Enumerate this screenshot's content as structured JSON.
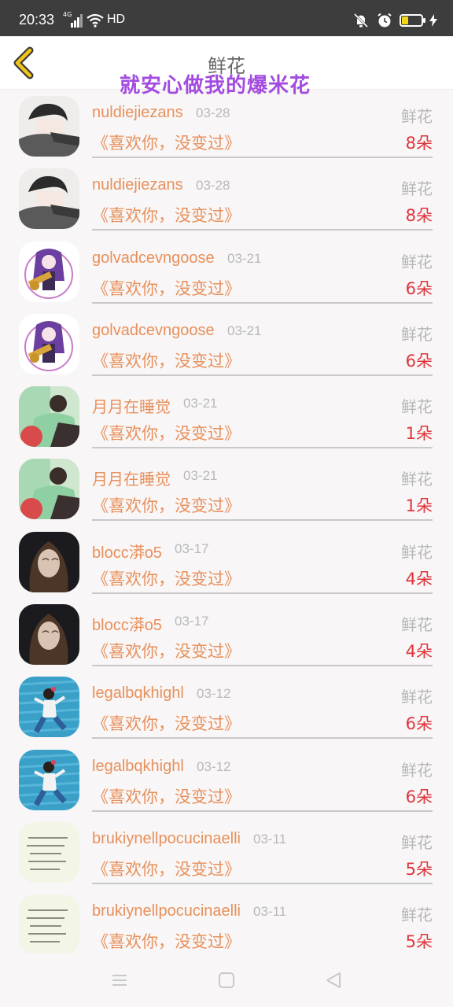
{
  "status_bar": {
    "time": "20:33",
    "network": "4G",
    "hd": "HD",
    "icons": [
      "signal-icon",
      "wifi-icon",
      "mute-icon",
      "alarm-icon",
      "battery-icon",
      "charging-icon"
    ]
  },
  "header": {
    "title": "鲜花",
    "back_icon": "chevron-left-icon"
  },
  "overlay": {
    "text": "就安心做我的爆米花"
  },
  "items": [
    {
      "name": "nuldiejiezans",
      "date": "03-28",
      "gift": "鲜花",
      "message": "《喜欢你，没变过》",
      "count": "8朵",
      "avatar": "anime-boy"
    },
    {
      "name": "nuldiejiezans",
      "date": "03-28",
      "gift": "鲜花",
      "message": "《喜欢你，没变过》",
      "count": "8朵",
      "avatar": "anime-boy"
    },
    {
      "name": "golvadcevngoose",
      "date": "03-21",
      "gift": "鲜花",
      "message": "《喜欢你，没变过》",
      "count": "6朵",
      "avatar": "anime-girl"
    },
    {
      "name": "golvadcevngoose",
      "date": "03-21",
      "gift": "鲜花",
      "message": "《喜欢你，没变过》",
      "count": "6朵",
      "avatar": "anime-girl"
    },
    {
      "name": "月月在睡觉",
      "date": "03-21",
      "gift": "鲜花",
      "message": "《喜欢你，没变过》",
      "count": "1朵",
      "avatar": "photo-green"
    },
    {
      "name": "月月在睡觉",
      "date": "03-21",
      "gift": "鲜花",
      "message": "《喜欢你，没变过》",
      "count": "1朵",
      "avatar": "photo-green"
    },
    {
      "name": "blocc漭o5",
      "date": "03-17",
      "gift": "鲜花",
      "message": "《喜欢你，没变过》",
      "count": "4朵",
      "avatar": "photo-woman"
    },
    {
      "name": "blocc漭o5",
      "date": "03-17",
      "gift": "鲜花",
      "message": "《喜欢你，没变过》",
      "count": "4朵",
      "avatar": "photo-woman"
    },
    {
      "name": "legalbqkhighl",
      "date": "03-12",
      "gift": "鲜花",
      "message": "《喜欢你，没变过》",
      "count": "6朵",
      "avatar": "photo-blue"
    },
    {
      "name": "legalbqkhighl",
      "date": "03-12",
      "gift": "鲜花",
      "message": "《喜欢你，没变过》",
      "count": "6朵",
      "avatar": "photo-blue"
    },
    {
      "name": "brukiynellpocucinaelli",
      "date": "03-11",
      "gift": "鲜花",
      "message": "《喜欢你，没变过》",
      "count": "5朵",
      "avatar": "text-card"
    },
    {
      "name": "brukiynellpocucinaelli",
      "date": "03-11",
      "gift": "鲜花",
      "message": "《喜欢你，没变过》",
      "count": "5朵",
      "avatar": "text-card"
    }
  ],
  "nav_bar": {
    "icons": [
      "menu-icon",
      "home-icon",
      "back-icon"
    ]
  },
  "colors": {
    "accent": "#e8905b",
    "count": "#e0343c",
    "overlay": "#a34be0",
    "back_arrow": "#f0c419"
  }
}
